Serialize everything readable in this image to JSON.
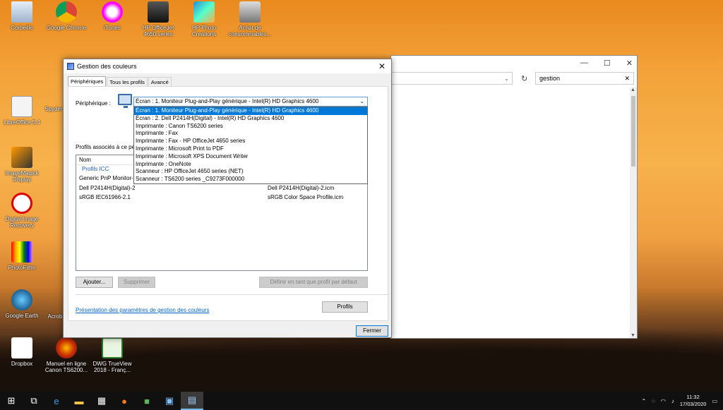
{
  "desktop": {
    "icons": [
      {
        "label": "Corbeille"
      },
      {
        "label": "Google Chrome"
      },
      {
        "label": "iTunes"
      },
      {
        "label": "HP OfficeJet 4650 series"
      },
      {
        "label": "HP Photo Creations"
      },
      {
        "label": "Achat de consommables..."
      },
      {
        "label": "LibreOffice 5.4"
      },
      {
        "label": "Spyder"
      },
      {
        "label": "ImageMagick Display"
      },
      {
        "label": "Digital Image Recovery"
      },
      {
        "label": "PhotoFiltre"
      },
      {
        "label": "Google Earth"
      },
      {
        "label": "Acrob"
      },
      {
        "label": "Dropbox"
      },
      {
        "label": "Manuel en ligne Canon TS6200..."
      },
      {
        "label": "DWG TrueView 2018 - Franç..."
      }
    ]
  },
  "explorer": {
    "search_value": "gestion",
    "minimize": "—",
    "maximize": "☐",
    "close": "✕"
  },
  "dialog": {
    "title": "Gestion des couleurs",
    "tabs": [
      "Périphériques",
      "Tous les profils",
      "Avancé"
    ],
    "device_label": "Périphérique :",
    "device_selected": "Écran : 1. Moniteur Plug-and-Play générique - Intel(R) HD Graphics 4600",
    "device_options": [
      "Écran : 1. Moniteur Plug-and-Play générique - Intel(R) HD Graphics 4600",
      "Écran : 2. Dell P2414H(Digital) - Intel(R) HD Graphics 4600",
      "Imprimante : Canon TS6200 series",
      "Imprimante : Fax",
      "Imprimante : Fax - HP OfficeJet 4650 series",
      "Imprimante : Microsoft Print to PDF",
      "Imprimante : Microsoft XPS Document Writer",
      "Imprimante : OneNote",
      "Scanneur :   HP OfficeJet 4650 series (NET)",
      "Scanneur :   TS6200 series _C9273F000000"
    ],
    "assoc_label": "Profils associés à ce pér",
    "list": {
      "header": "Nom",
      "group": "Profils ICC",
      "rows": [
        {
          "name": "Generic PnP Monitor-1",
          "file": ""
        },
        {
          "name": "Dell P2414H(Digital)-2",
          "file": "Dell P2414H(Digital)-2.icm"
        },
        {
          "name": "sRGB IEC61966-2.1",
          "file": "sRGB Color Space Profile.icm"
        }
      ]
    },
    "add_button": "Ajouter...",
    "remove_button": "Supprimer",
    "default_button": "Définir en tant que profil par défaut",
    "link": "Présentation des paramètres de gestion des couleurs",
    "profiles_button": "Profils",
    "close_button": "Fermer"
  },
  "taskbar": {
    "time": "11:32",
    "date": "17/03/2020"
  }
}
